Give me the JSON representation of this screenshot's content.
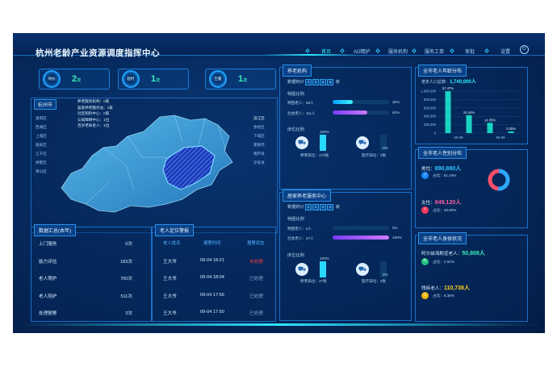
{
  "header": {
    "title": "杭州老龄产业资源调度指挥中心",
    "nav": [
      "首页",
      "AD精护",
      "服务机构",
      "服务工单",
      "审批",
      "设置"
    ]
  },
  "stats": [
    {
      "label": "待办",
      "value": "2",
      "unit": "次"
    },
    {
      "label": "超时",
      "value": "1",
      "unit": "次"
    },
    {
      "label": "告警",
      "value": "1",
      "unit": "次"
    }
  ],
  "map": {
    "city": "杭州市",
    "legend": [
      "养老服务机构：0家",
      "居家养老服务站：1家",
      "社区照料中心：0家",
      "认知障碍中心：1位",
      "百岁老寿星人：1位"
    ],
    "left_districts": [
      "富阳区",
      "西湖区",
      "上城区",
      "临安区",
      "江干区",
      "拱墅区",
      "萧山区"
    ],
    "right_districts": [
      "滨江区",
      "余杭区",
      "下城区",
      "建德市",
      "桐庐县",
      "淳安县"
    ]
  },
  "summary": {
    "title": "数据汇总(本年)",
    "rows": [
      {
        "label": "上门服务",
        "value": "0次"
      },
      {
        "label": "能力评估",
        "value": "183次"
      },
      {
        "label": "老人照护",
        "value": "700次"
      },
      {
        "label": "老人陪护",
        "value": "511次"
      },
      {
        "label": "处理报警",
        "value": "3次"
      }
    ]
  },
  "alarms": {
    "title": "老人定位警报",
    "headers": [
      "老人姓名",
      "报警时间",
      "报警状态"
    ],
    "rows": [
      {
        "name": "王大爷",
        "time": "09-04 18:21",
        "status": "未处理"
      },
      {
        "name": "王大爷",
        "time": "09-04 18:04",
        "status": "已处理"
      },
      {
        "name": "王大爷",
        "time": "09-04 17:56",
        "status": "已处理"
      },
      {
        "name": "王大爷",
        "time": "09-04 17:50",
        "status": "已处理"
      }
    ]
  },
  "institution": {
    "title": "养老机构",
    "stat_label": "数据统计",
    "digits": [
      "0",
      "0",
      "8",
      "8"
    ],
    "unit": "家",
    "special_title": "特困比例",
    "rows": [
      {
        "label": "特困老人：",
        "value": "68人",
        "pct": "36%",
        "frac": 0.36
      },
      {
        "label": "社会老人：",
        "value": "111人",
        "pct": "62%",
        "frac": 0.62
      }
    ],
    "bed_title": "床位比例",
    "beds": [
      {
        "pct": "100%",
        "label": "养老床位：179张",
        "frac": 1
      },
      {
        "pct": "0%",
        "label": "医疗床位：0张",
        "frac": 0
      }
    ]
  },
  "home_center": {
    "title": "居家养老服务中心",
    "stat_label": "数据统计",
    "digits": [
      "0",
      "0",
      "0",
      "9"
    ],
    "unit": "家",
    "special_title": "特困比例",
    "rows": [
      {
        "label": "特困老人：",
        "value": "0人",
        "pct": "0%",
        "frac": 0
      },
      {
        "label": "社会老人：",
        "value": "27人",
        "pct": "100%",
        "frac": 1
      }
    ],
    "bed_title": "床位比例",
    "beds": [
      {
        "pct": "100%",
        "label": "养老床位：27张",
        "frac": 1
      },
      {
        "pct": "0%",
        "label": "医疗床位：0张",
        "frac": 0
      }
    ]
  },
  "age": {
    "title": "全市老人年龄分布",
    "subtitle": "老年人口总数：",
    "total": "1,740,000人",
    "chart_data": {
      "type": "bar",
      "categories": [
        "60-69",
        "70-79",
        "80-89",
        "90+"
      ],
      "values": [
        998000,
        426000,
        244000,
        40000
      ],
      "labels": [
        "57.47%",
        "24.44%",
        "14.05%",
        "2.05%"
      ],
      "xticks": [
        "60-69",
        "80-89"
      ],
      "yticks": [
        "1,000,000",
        "800,000",
        "600,000",
        "400,000",
        "200,000",
        "0"
      ],
      "ylim": [
        0,
        1000000
      ]
    }
  },
  "gender": {
    "title": "全市老人性别分布",
    "male_label": "男性：",
    "male": "890,880人",
    "male_pct": "占比：51.20%",
    "female_label": "女性：",
    "female": "849,120人",
    "female_pct": "占比：48.80%",
    "male_frac": 0.512
  },
  "health": {
    "title": "全市老人身体状况",
    "rows": [
      {
        "label": "阿尔兹海默症老人：",
        "value": "50,808人",
        "pct": "占比：2.92%"
      },
      {
        "label": "残疾老人：",
        "value": "110,738人",
        "pct": "占比：6.36%"
      }
    ]
  },
  "colors": {
    "accent": "#30f0ff",
    "green": "#3cf2b7",
    "red": "#ff3b3b",
    "pink": "#ff5da1",
    "yellow": "#ffd21e"
  }
}
